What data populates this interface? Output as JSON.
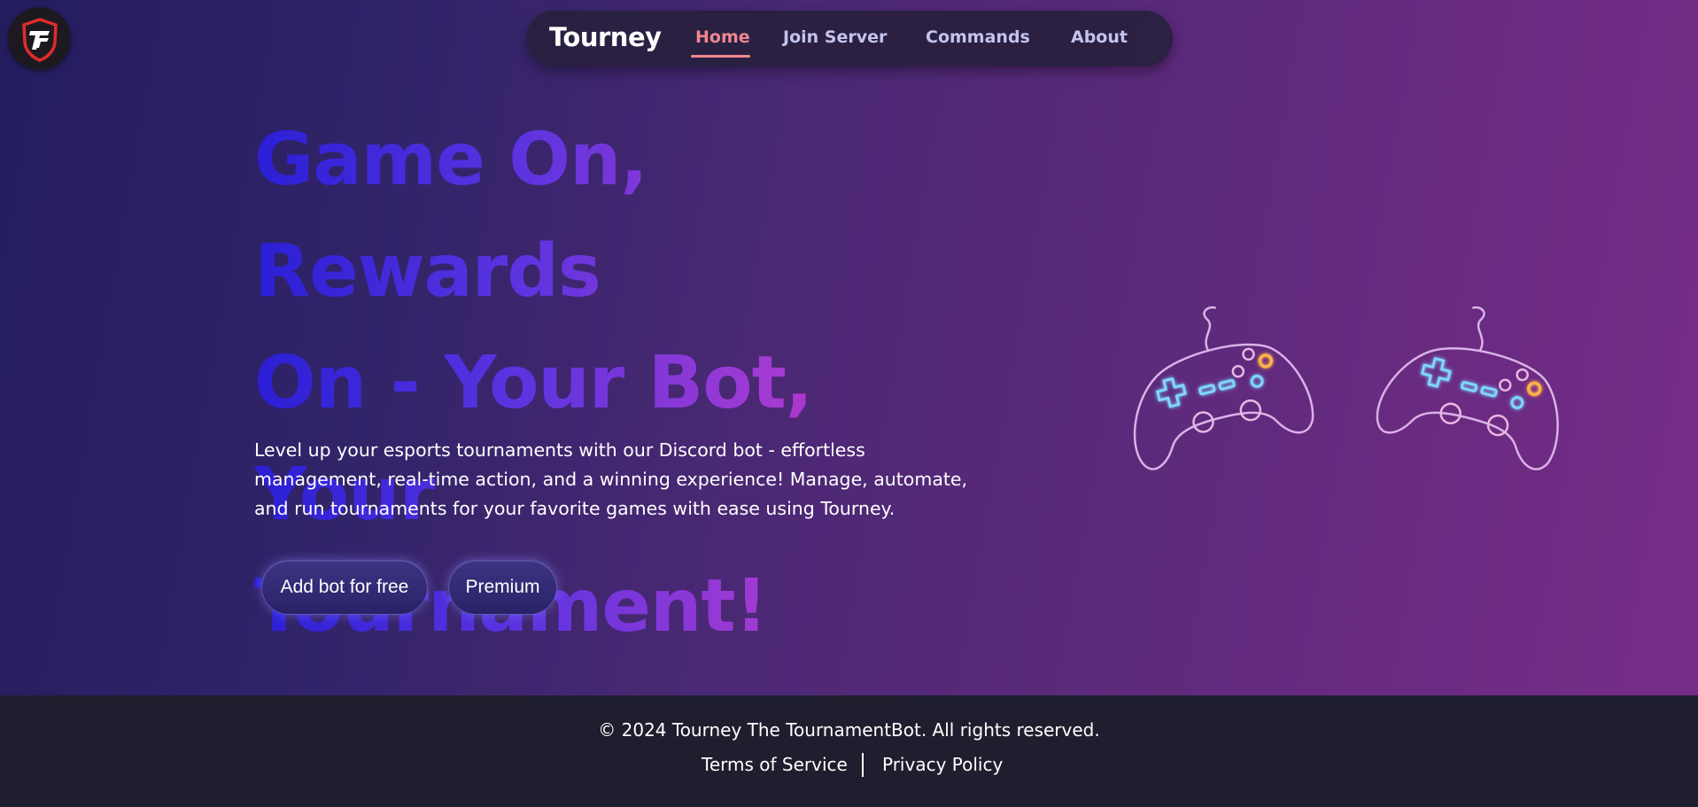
{
  "brand": {
    "name": "Tourney"
  },
  "nav": {
    "items": [
      {
        "label": "Home",
        "active": true
      },
      {
        "label": "Join Server",
        "active": false
      },
      {
        "label": "Commands",
        "active": false
      },
      {
        "label": "About",
        "active": false
      }
    ]
  },
  "hero": {
    "headline_lines": [
      "Game On, Rewards",
      "On - Your Bot, Your",
      "Tournament!"
    ],
    "description": "Level up your esports tournaments with our Discord bot - effortless management, real-time action, and a winning experience! Manage, automate, and run tournaments for your favorite games with ease using Tourney.",
    "buttons": {
      "primary": "Add bot for free",
      "secondary": "Premium"
    },
    "illustration_icons": [
      "gamepad-icon",
      "gamepad-icon"
    ]
  },
  "footer": {
    "copyright": "© 2024 Tourney The TournamentBot. All rights reserved.",
    "links": [
      "Terms of Service",
      "Privacy Policy"
    ]
  },
  "colors": {
    "nav_active": "#f0868f",
    "nav_inactive": "#c3c4ee",
    "headline_gradient": [
      "#2a1fd6",
      "#5a34e0",
      "#a43ad2",
      "#e61fb0"
    ],
    "footer_bg": "#1f1e2e",
    "logo_red": "#e02b2b"
  }
}
